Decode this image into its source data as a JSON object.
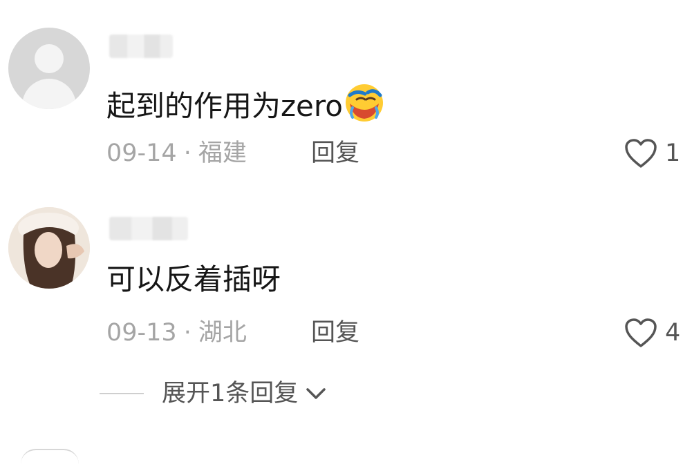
{
  "comments": [
    {
      "avatar_icon": "default-user-icon",
      "content": "起到的作用为zero",
      "emoji": "laughing-crying-emoji",
      "date": "09-14",
      "separator": "·",
      "location": "福建",
      "reply_label": "回复",
      "like_icon": "heart-outline-icon",
      "like_count": "1"
    },
    {
      "avatar_icon": "user-photo",
      "content": "可以反着插呀",
      "date": "09-13",
      "separator": "·",
      "location": "湖北",
      "reply_label": "回复",
      "like_icon": "heart-outline-icon",
      "like_count": "4"
    }
  ],
  "expand_replies": {
    "label": "展开1条回复",
    "icon": "chevron-down-icon"
  },
  "colors": {
    "text_primary": "#161616",
    "text_secondary": "#a5a5a5",
    "text_action": "#555555",
    "avatar_default_bg": "#d7d7d7"
  }
}
